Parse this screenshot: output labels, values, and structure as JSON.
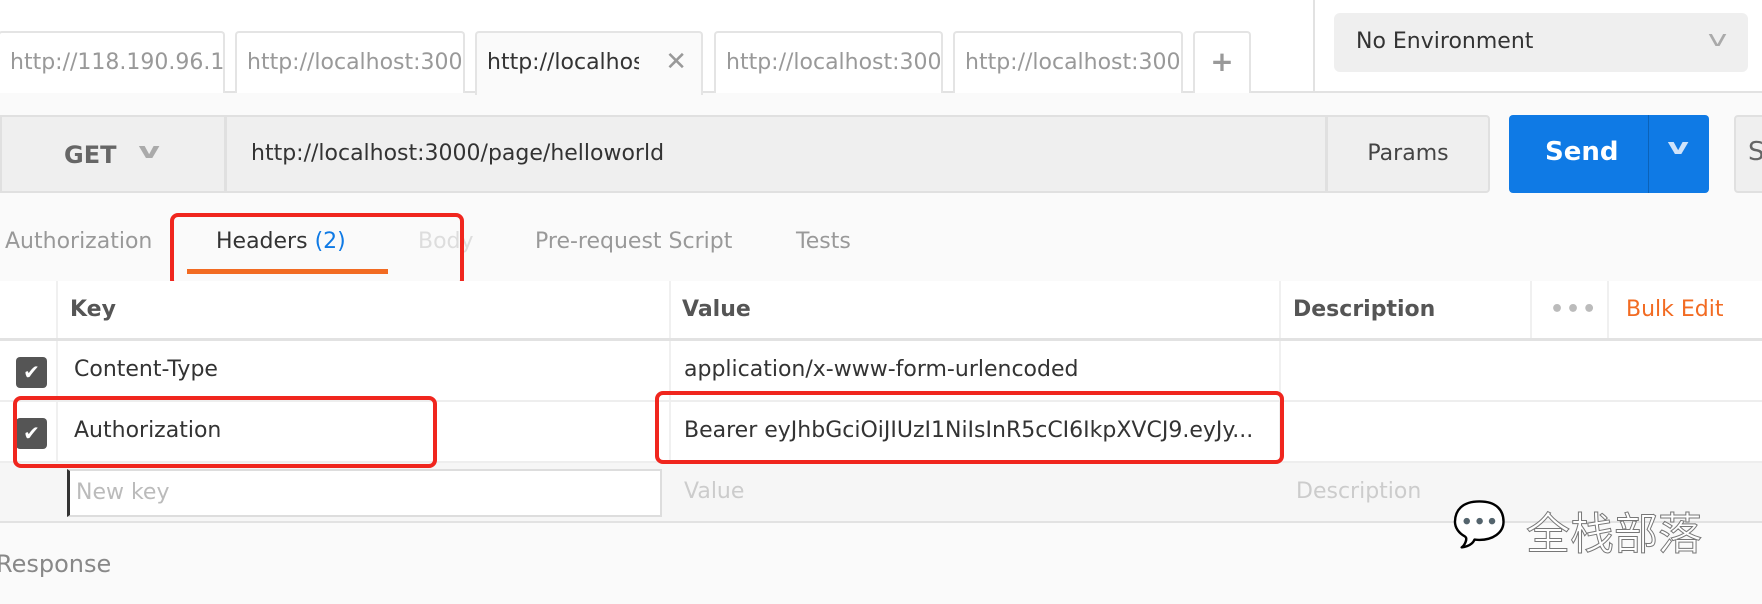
{
  "tabs": [
    {
      "label": "http://118.190.96.1"
    },
    {
      "label": "http://localhost:300"
    },
    {
      "label": "http://localhos",
      "active": true
    },
    {
      "label": "http://localhost:300"
    },
    {
      "label": "http://localhost:300"
    }
  ],
  "new_tab_label": "+",
  "environment": {
    "selected": "No Environment"
  },
  "request": {
    "method": "GET",
    "url": "http://localhost:3000/page/helloworld",
    "params_label": "Params",
    "send_label": "Send",
    "save_label": "S"
  },
  "subtabs": {
    "authorization": "Authorization",
    "headers": "Headers",
    "headers_count": "(2)",
    "body": "Body",
    "prerequest": "Pre-request Script",
    "tests": "Tests"
  },
  "table": {
    "columns": {
      "key": "Key",
      "value": "Value",
      "description": "Description"
    },
    "more_icon": "more-dots-icon",
    "bulk_edit": "Bulk Edit",
    "rows": [
      {
        "checked": true,
        "key": "Content-Type",
        "value": "application/x-www-form-urlencoded"
      },
      {
        "checked": true,
        "key": "Authorization",
        "value": "Bearer eyJhbGciOiJIUzI1NiIsInR5cCI6IkpXVCJ9.eyJy..."
      }
    ],
    "new_row": {
      "key_placeholder": "New key",
      "value_placeholder": "Value",
      "description_placeholder": "Description"
    }
  },
  "response_label": "Response",
  "watermark": "全栈部落",
  "colors": {
    "send": "#0f7ae5",
    "active_tab_underline": "#f26b22",
    "highlight": "#f0261e",
    "headers_count": "#0f7ae5",
    "bulk_edit": "#f26b22"
  }
}
